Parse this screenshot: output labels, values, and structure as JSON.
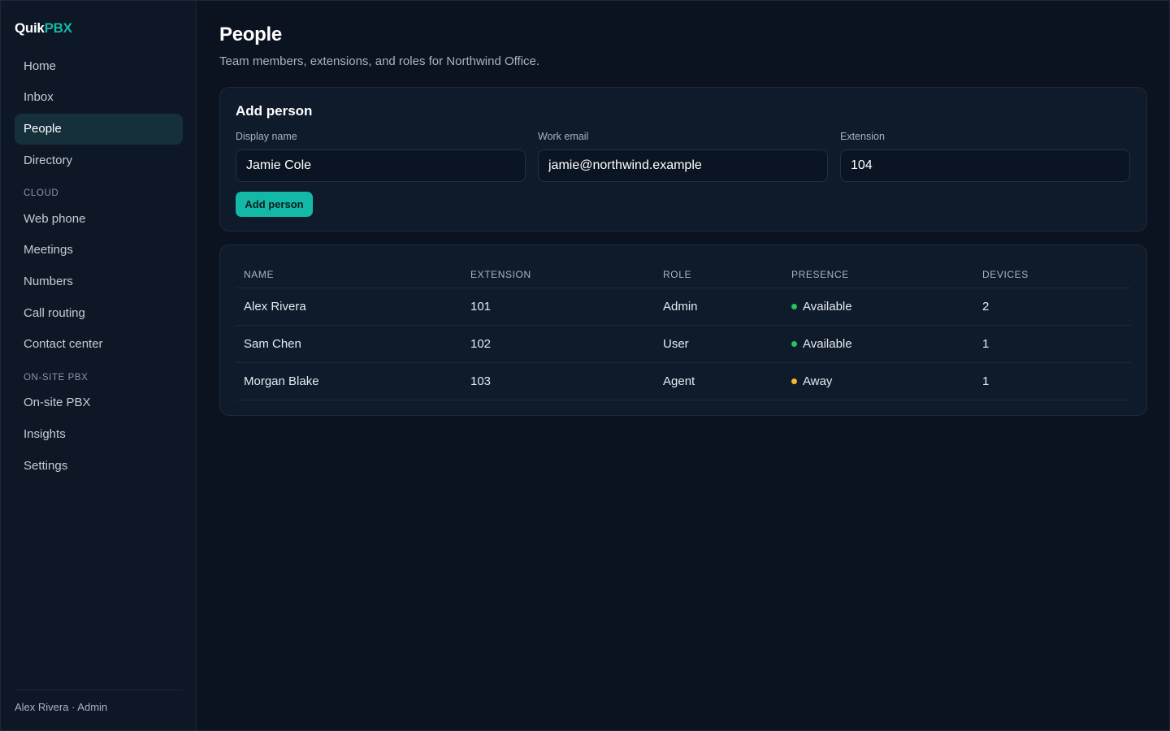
{
  "brand": {
    "part1": "Quik",
    "part2": "PBX",
    "accent": "#14b8a6"
  },
  "sidebar": {
    "items": [
      {
        "label": "Home"
      },
      {
        "label": "Inbox"
      },
      {
        "label": "People",
        "active": true
      },
      {
        "label": "Directory"
      }
    ],
    "section_cloud": "CLOUD",
    "cloud_items": [
      {
        "label": "Web phone"
      },
      {
        "label": "Meetings"
      },
      {
        "label": "Numbers"
      },
      {
        "label": "Call routing"
      },
      {
        "label": "Contact center"
      }
    ],
    "section_onsite": "ON-SITE PBX",
    "onsite_items": [
      {
        "label": "On-site PBX"
      },
      {
        "label": "Insights"
      },
      {
        "label": "Settings"
      }
    ],
    "user": "Alex Rivera · Admin"
  },
  "page": {
    "title": "People",
    "subtitle": "Team members, extensions, and roles for Northwind Office."
  },
  "add_form": {
    "title": "Add person",
    "fields": [
      {
        "label": "Display name",
        "value": "Jamie Cole"
      },
      {
        "label": "Work email",
        "value": "jamie@northwind.example"
      },
      {
        "label": "Extension",
        "value": "104"
      }
    ],
    "button": "Add person"
  },
  "table": {
    "headers": [
      "NAME",
      "EXTENSION",
      "ROLE",
      "PRESENCE",
      "DEVICES"
    ],
    "rows": [
      {
        "name": "Alex Rivera",
        "extension": "101",
        "role": "Admin",
        "presence": "Available",
        "presence_color": "#22c55e",
        "devices": "2"
      },
      {
        "name": "Sam Chen",
        "extension": "102",
        "role": "User",
        "presence": "Available",
        "presence_color": "#22c55e",
        "devices": "1"
      },
      {
        "name": "Morgan Blake",
        "extension": "103",
        "role": "Agent",
        "presence": "Away",
        "presence_color": "#f5b82e",
        "devices": "1"
      }
    ]
  }
}
